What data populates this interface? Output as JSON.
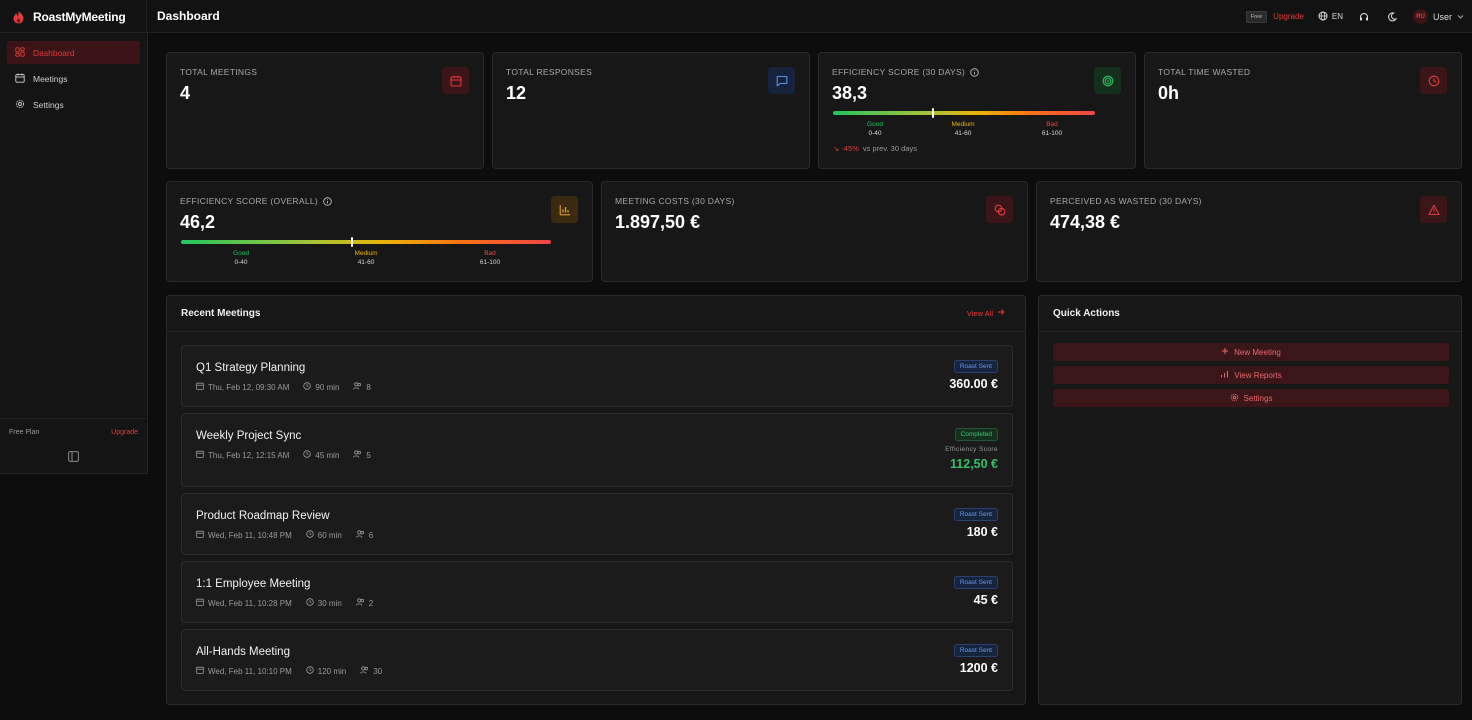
{
  "app": {
    "name": "RoastMyMeeting"
  },
  "header": {
    "title": "Dashboard",
    "plan_pill": "Free",
    "upgrade_label": "Upgrade",
    "language": "EN",
    "user_initials": "RU",
    "user_label": "User"
  },
  "sidebar": {
    "items": [
      {
        "label": "Dashboard",
        "icon": "dashboard-icon",
        "active": true
      },
      {
        "label": "Meetings",
        "icon": "calendar-icon",
        "active": false
      },
      {
        "label": "Settings",
        "icon": "gear-icon",
        "active": false
      }
    ],
    "plan_label": "Free Plan",
    "plan_upgrade": "Upgrade"
  },
  "stats": {
    "total_meetings": {
      "label": "Total Meetings",
      "value": "4"
    },
    "total_responses": {
      "label": "Total Responses",
      "value": "12"
    },
    "efficiency_30": {
      "label": "Efficiency Score (30 Days)",
      "value": "38,3",
      "score": 38.3,
      "legend": [
        {
          "name": "Good",
          "range": "0-40"
        },
        {
          "name": "Medium",
          "range": "41-60"
        },
        {
          "name": "Bad",
          "range": "61-100"
        }
      ],
      "trend_delta": "↘ -45%",
      "trend_text": "vs prev. 30 days"
    },
    "total_time_wasted": {
      "label": "Total Time Wasted",
      "value": "0h"
    },
    "efficiency_overall": {
      "label": "Efficiency Score (Overall)",
      "value": "46,2",
      "score": 46.2,
      "legend": [
        {
          "name": "Good",
          "range": "0-40"
        },
        {
          "name": "Medium",
          "range": "41-60"
        },
        {
          "name": "Bad",
          "range": "61-100"
        }
      ]
    },
    "meeting_costs": {
      "label": "Meeting Costs (30 Days)",
      "value": "1.897,50 €"
    },
    "perceived_wasted": {
      "label": "Perceived as Wasted (30 Days)",
      "value": "474,38 €"
    }
  },
  "recent": {
    "title": "Recent Meetings",
    "view_all": "View All",
    "meetings": [
      {
        "title": "Q1 Strategy Planning",
        "date": "Thu, Feb 12, 09:30 AM",
        "duration": "90 min",
        "attendees": "8",
        "badge": "Roast Sent",
        "badge_type": "blue",
        "cost": "360.00 €"
      },
      {
        "title": "Weekly Project Sync",
        "date": "Thu, Feb 12, 12:15 AM",
        "duration": "45 min",
        "attendees": "5",
        "badge": "Completed",
        "badge_type": "green",
        "eff_label": "Efficiency Score",
        "cost": "112,50 €"
      },
      {
        "title": "Product Roadmap Review",
        "date": "Wed, Feb 11, 10:48 PM",
        "duration": "60 min",
        "attendees": "6",
        "badge": "Roast Sent",
        "badge_type": "blue",
        "cost": "180 €"
      },
      {
        "title": "1:1 Employee Meeting",
        "date": "Wed, Feb 11, 10:28 PM",
        "duration": "30 min",
        "attendees": "2",
        "badge": "Roast Sent",
        "badge_type": "blue",
        "cost": "45 €"
      },
      {
        "title": "All-Hands Meeting",
        "date": "Wed, Feb 11, 10:10 PM",
        "duration": "120 min",
        "attendees": "30",
        "badge": "Roast Sent",
        "badge_type": "blue",
        "cost": "1200 €"
      }
    ]
  },
  "quick_actions": {
    "title": "Quick Actions",
    "actions": [
      {
        "label": "New Meeting",
        "icon": "plus-icon"
      },
      {
        "label": "View Reports",
        "icon": "bar-chart-icon"
      },
      {
        "label": "Settings",
        "icon": "gear-icon"
      }
    ]
  },
  "colors": {
    "accent": "#e23b3b",
    "background": "#0d0d0d",
    "card": "#171717",
    "good": "#22c55e",
    "medium": "#eab308",
    "bad": "#ef4444"
  }
}
